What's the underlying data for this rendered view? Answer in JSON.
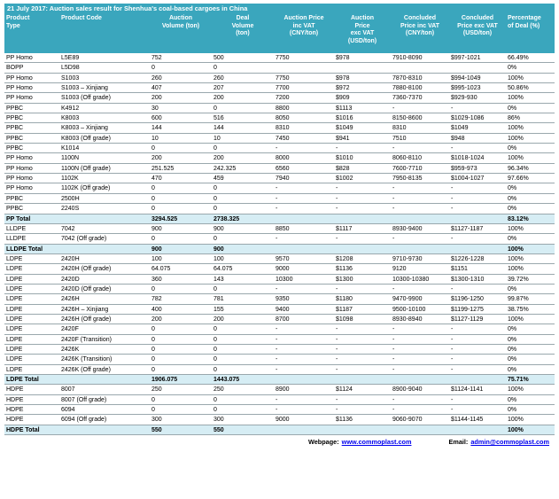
{
  "title": "21 July 2017: Auction sales result for Shenhua's coal-based cargoes in China",
  "headers": [
    "Product\nType",
    "Product Code",
    "Auction\nVolume (ton)",
    "Deal\nVolume\n(ton)",
    "Auction Price\ninc VAT\n(CNY/ton)",
    "Auction\nPrice\nexc VAT\n(USD/ton)",
    "Concluded\nPrice inc VAT\n(CNY/ton)",
    "Concluded\nPrice exc VAT\n(USD/ton)",
    "Percentage\nof Deal (%)"
  ],
  "rows": [
    [
      "PP Homo",
      "L5E89",
      "752",
      "500",
      "7750",
      "$978",
      "7910-8090",
      "$997-1021",
      "66.49%"
    ],
    [
      "BOPP",
      "L5D98",
      "0",
      "0",
      "",
      "",
      "",
      "",
      "0%"
    ],
    [
      "PP Homo",
      "S1003",
      "260",
      "260",
      "7750",
      "$978",
      "7870-8310",
      "$994-1049",
      "100%"
    ],
    [
      "PP Homo",
      "S1003 – Xinjiang",
      "407",
      "207",
      "7700",
      "$972",
      "7880-8100",
      "$995-1023",
      "50.86%"
    ],
    [
      "PP Homo",
      "S1003 (Off grade)",
      "200",
      "200",
      "7200",
      "$909",
      "7360-7370",
      "$929-930",
      "100%"
    ],
    [
      "PPBC",
      "K4912",
      "30",
      "0",
      "8800",
      "$1113",
      "-",
      "-",
      "0%"
    ],
    [
      "PPBC",
      "K8003",
      "600",
      "516",
      "8050",
      "$1016",
      "8150-8600",
      "$1029-1086",
      "86%"
    ],
    [
      "PPBC",
      "K8003 – Xinjiang",
      "144",
      "144",
      "8310",
      "$1049",
      "8310",
      "$1049",
      "100%"
    ],
    [
      "PPBC",
      "K8003 (Off grade)",
      "10",
      "10",
      "7450",
      "$941",
      "7510",
      "$948",
      "100%"
    ],
    [
      "PPBC",
      "K1014",
      "0",
      "0",
      "-",
      "-",
      "-",
      "-",
      "0%"
    ],
    [
      "PP Homo",
      "1100N",
      "200",
      "200",
      "8000",
      "$1010",
      "8060-8110",
      "$1018-1024",
      "100%"
    ],
    [
      "PP Homo",
      "1100N (Off grade)",
      "251.525",
      "242.325",
      "6560",
      "$828",
      "7600-7710",
      "$959-973",
      "96.34%"
    ],
    [
      "PP Homo",
      "1102K",
      "470",
      "459",
      "7940",
      "$1002",
      "7950-8135",
      "$1004-1027",
      "97.66%"
    ],
    [
      "PP Homo",
      "1102K (Off grade)",
      "0",
      "0",
      "-",
      "-",
      "-",
      "-",
      "0%"
    ],
    [
      "PPBC",
      "2500H",
      "0",
      "0",
      "-",
      "-",
      "-",
      "-",
      "0%"
    ],
    [
      "PPBC",
      "2240S",
      "0",
      "0",
      "-",
      "-",
      "-",
      "-",
      "0%"
    ],
    [
      "PP Total",
      "",
      "3294.525",
      "2738.325",
      "",
      "",
      "",
      "",
      "83.12%"
    ],
    [
      "LLDPE",
      "7042",
      "900",
      "900",
      "8850",
      "$1117",
      "8930-9400",
      "$1127-1187",
      "100%"
    ],
    [
      "LLDPE",
      "7042 (Off grade)",
      "0",
      "0",
      "-",
      "-",
      "-",
      "-",
      "0%"
    ],
    [
      "LLDPE Total",
      "",
      "900",
      "900",
      "",
      "",
      "",
      "",
      "100%"
    ],
    [
      "LDPE",
      "2420H",
      "100",
      "100",
      "9570",
      "$1208",
      "9710-9730",
      "$1226-1228",
      "100%"
    ],
    [
      "LDPE",
      "2420H (Off grade)",
      "64.075",
      "64.075",
      "9000",
      "$1136",
      "9120",
      "$1151",
      "100%"
    ],
    [
      "LDPE",
      "2420D",
      "360",
      "143",
      "10300",
      "$1300",
      "10300-10380",
      "$1300-1310",
      "39.72%"
    ],
    [
      "LDPE",
      "2420D (Off grade)",
      "0",
      "0",
      "-",
      "-",
      "-",
      "-",
      "0%"
    ],
    [
      "LDPE",
      "2426H",
      "782",
      "781",
      "9350",
      "$1180",
      "9470-9900",
      "$1196-1250",
      "99.87%"
    ],
    [
      "LDPE",
      "2426H – Xinjiang",
      "400",
      "155",
      "9400",
      "$1187",
      "9500-10100",
      "$1199-1275",
      "38.75%"
    ],
    [
      "LDPE",
      "2426H (Off grade)",
      "200",
      "200",
      "8700",
      "$1098",
      "8930-8940",
      "$1127-1129",
      "100%"
    ],
    [
      "LDPE",
      "2420F",
      "0",
      "0",
      "-",
      "-",
      "-",
      "-",
      "0%"
    ],
    [
      "LDPE",
      "2420F (Transition)",
      "0",
      "0",
      "-",
      "-",
      "-",
      "-",
      "0%"
    ],
    [
      "LDPE",
      "2426K",
      "0",
      "0",
      "-",
      "-",
      "-",
      "-",
      "0%"
    ],
    [
      "LDPE",
      "2426K (Transition)",
      "0",
      "0",
      "-",
      "-",
      "-",
      "-",
      "0%"
    ],
    [
      "LDPE",
      "2426K (Off grade)",
      "0",
      "0",
      "-",
      "-",
      "-",
      "-",
      "0%"
    ],
    [
      "LDPE Total",
      "",
      "1906.075",
      "1443.075",
      "",
      "",
      "",
      "",
      "75.71%"
    ],
    [
      "HDPE",
      "8007",
      "250",
      "250",
      "8900",
      "$1124",
      "8900-9040",
      "$1124-1141",
      "100%"
    ],
    [
      "HDPE",
      "8007 (Off grade)",
      "0",
      "0",
      "-",
      "-",
      "-",
      "-",
      "0%"
    ],
    [
      "HDPE",
      "6094",
      "0",
      "0",
      "-",
      "-",
      "-",
      "-",
      "0%"
    ],
    [
      "HDPE",
      "6094 (Off grade)",
      "300",
      "300",
      "9000",
      "$1136",
      "9060-9070",
      "$1144-1145",
      "100%"
    ],
    [
      "HDPE Total",
      "",
      "550",
      "550",
      "",
      "",
      "",
      "",
      "100%"
    ]
  ],
  "footer": {
    "webpage_label": "Webpage:",
    "webpage_link": "www.commoplast.com",
    "email_label": "Email:",
    "email_link": "admin@commoplast.com"
  },
  "colors": {
    "header_bg": "#3aa6bd",
    "total_bg": "#d6edf4",
    "link": "#0000ee"
  }
}
